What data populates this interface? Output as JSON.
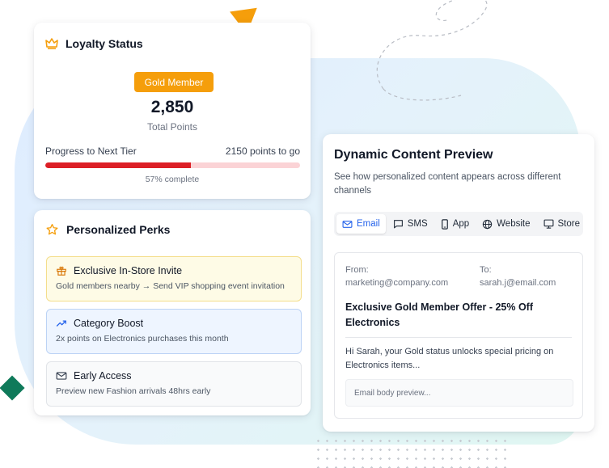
{
  "colors": {
    "accent_orange": "#f59e0b",
    "progress_red": "#dc1f26",
    "active_blue": "#2563eb",
    "diamond_green": "#0f7a5a"
  },
  "loyalty": {
    "title": "Loyalty Status",
    "icon": "crown-icon",
    "tier_badge": "Gold Member",
    "points": "2,850",
    "points_label": "Total Points",
    "progress_label": "Progress to Next Tier",
    "points_to_go": "2150 points to go",
    "progress_fraction": 0.57,
    "progress_text": "57% complete"
  },
  "perks": {
    "title": "Personalized Perks",
    "icon": "star-icon",
    "items": [
      {
        "icon": "gift-icon",
        "title": "Exclusive In-Store Invite",
        "description": "Gold members nearby → Send VIP shopping event invitation"
      },
      {
        "icon": "trending-up-icon",
        "title": "Category Boost",
        "description": "2x points on Electronics purchases this month"
      },
      {
        "icon": "mail-icon",
        "title": "Early Access",
        "description": "Preview new Fashion arrivals 48hrs early"
      }
    ]
  },
  "preview": {
    "title": "Dynamic Content Preview",
    "subtitle": "See how personalized content appears across different channels",
    "tabs": [
      {
        "icon": "mail-icon",
        "label": "Email",
        "active": true
      },
      {
        "icon": "chat-icon",
        "label": "SMS",
        "active": false
      },
      {
        "icon": "phone-icon",
        "label": "App",
        "active": false
      },
      {
        "icon": "globe-icon",
        "label": "Website",
        "active": false
      },
      {
        "icon": "monitor-icon",
        "label": "Store",
        "active": false
      }
    ],
    "email": {
      "from_label": "From:",
      "from_value": "marketing@company.com",
      "to_label": "To:",
      "to_value": "sarah.j@email.com",
      "subject": "Exclusive Gold Member Offer - 25% Off Electronics",
      "snippet": "Hi Sarah, your Gold status unlocks special pricing on Electronics items...",
      "body_placeholder": "Email body preview..."
    }
  }
}
